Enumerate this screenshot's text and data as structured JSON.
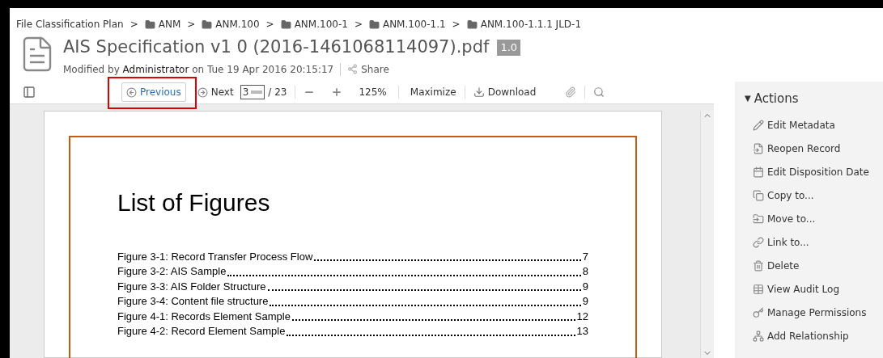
{
  "breadcrumb": [
    {
      "label": "File Classification Plan",
      "folder": false
    },
    {
      "label": "ANM",
      "folder": true
    },
    {
      "label": "ANM.100",
      "folder": true
    },
    {
      "label": "ANM.100-1",
      "folder": true
    },
    {
      "label": "ANM.100-1.1",
      "folder": true
    },
    {
      "label": "ANM.100-1.1.1 JLD-1",
      "folder": true
    }
  ],
  "separator": ">",
  "document": {
    "title": "AIS Specification v1 0 (2016-1461068114097).pdf",
    "version": "1.0",
    "modified_prefix": "Modified by",
    "modified_by": "Administrator",
    "modified_suffix": "on Tue 19 Apr 2016 20:15:17",
    "share": "Share"
  },
  "toolbar": {
    "previous": "Previous",
    "previous_highlighted": true,
    "next": "Next",
    "page": "3",
    "page_total": "/ 23",
    "zoom": "125%",
    "maximize": "Maximize",
    "download": "Download"
  },
  "page": {
    "heading": "List of Figures",
    "entries": [
      {
        "label": "Figure 3-1: Record Transfer Process Flow",
        "page": "7"
      },
      {
        "label": "Figure 3-2: AIS Sample",
        "page": "8"
      },
      {
        "label": "Figure 3-3: AIS Folder Structure",
        "page": "9"
      },
      {
        "label": "Figure 3-4: Content file structure",
        "page": "9"
      },
      {
        "label": "Figure 4-1: Records Element Sample",
        "page": "12"
      },
      {
        "label": "Figure 4-2: Record Element Sample",
        "page": "13"
      }
    ]
  },
  "actions": {
    "toggle": "▼",
    "title": "Actions",
    "expanded": true,
    "items": [
      "Edit Metadata",
      "Reopen Record",
      "Edit Disposition Date",
      "Copy to...",
      "Move to...",
      "Link to...",
      "Delete",
      "View Audit Log",
      "Manage Permissions",
      "Add Relationship"
    ]
  }
}
